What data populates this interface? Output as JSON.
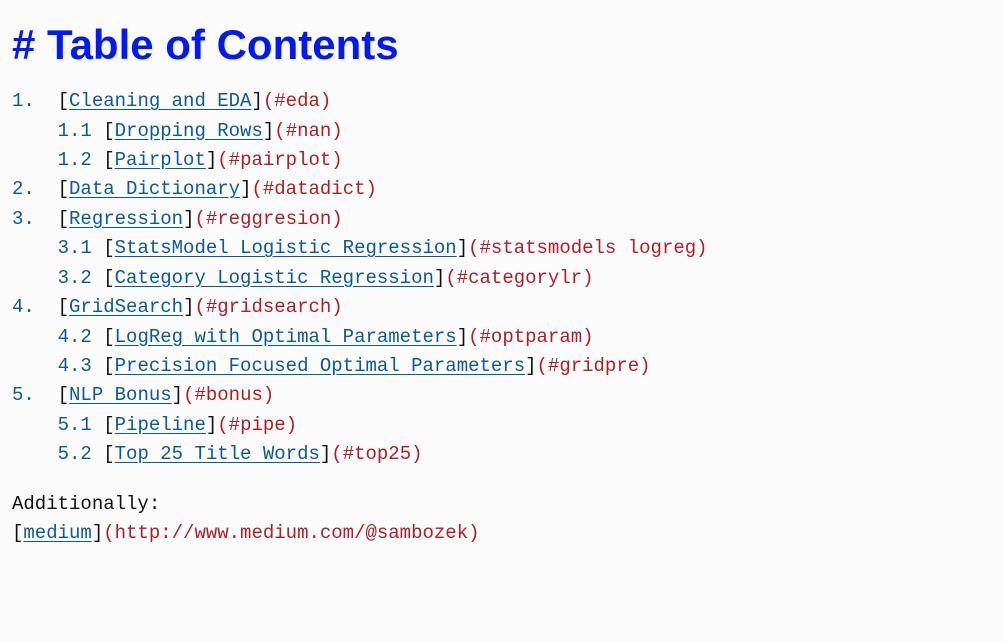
{
  "heading": "# Table of Contents",
  "toc": {
    "items": [
      {
        "indent0": "",
        "num": "1.",
        "gap": "  ",
        "label": "Cleaning and EDA",
        "anchor": "#eda"
      },
      {
        "indent0": "    ",
        "num": "1.1",
        "gap": " ",
        "label": "Dropping Rows",
        "anchor": "#nan"
      },
      {
        "indent0": "    ",
        "num": "1.2",
        "gap": " ",
        "label": "Pairplot",
        "anchor": "#pairplot"
      },
      {
        "indent0": "",
        "num": "2.",
        "gap": "  ",
        "label": "Data Dictionary",
        "anchor": "#datadict"
      },
      {
        "indent0": "",
        "num": "3.",
        "gap": "  ",
        "label": "Regression",
        "anchor": "#reggresion"
      },
      {
        "indent0": "    ",
        "num": "3.1",
        "gap": " ",
        "label": "StatsModel Logistic Regression",
        "anchor": "#statsmodels logreg"
      },
      {
        "indent0": "    ",
        "num": "3.2",
        "gap": " ",
        "label": "Category Logistic Regression",
        "anchor": "#categorylr"
      },
      {
        "indent0": "",
        "num": "4.",
        "gap": "  ",
        "label": "GridSearch",
        "anchor": "#gridsearch"
      },
      {
        "indent0": "    ",
        "num": "4.2",
        "gap": " ",
        "label": "LogReg with Optimal Parameters",
        "anchor": "#optparam"
      },
      {
        "indent0": "    ",
        "num": "4.3",
        "gap": " ",
        "label": "Precision Focused Optimal Parameters",
        "anchor": "#gridpre"
      },
      {
        "indent0": "",
        "num": "5.",
        "gap": "  ",
        "label": "NLP Bonus",
        "anchor": "#bonus"
      },
      {
        "indent0": "    ",
        "num": "5.1",
        "gap": " ",
        "label": "Pipeline",
        "anchor": "#pipe"
      },
      {
        "indent0": "    ",
        "num": "5.2",
        "gap": " ",
        "label": "Top 25 Title Words",
        "anchor": "#top25"
      }
    ]
  },
  "footer": {
    "additionally": "Additionally:",
    "link_label": "medium",
    "link_url": "http://www.medium.com/@sambozek"
  }
}
